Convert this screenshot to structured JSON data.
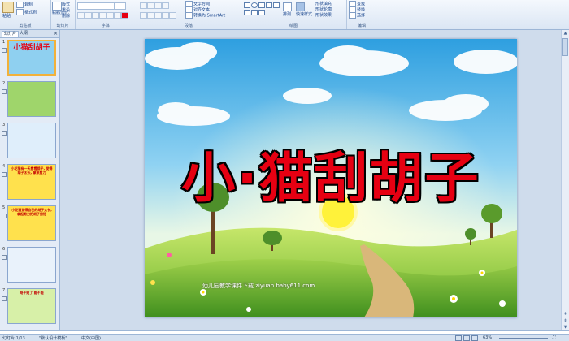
{
  "ribbon": {
    "clipboard": {
      "paste": "粘贴",
      "copy": "复制",
      "format_painter": "格式刷",
      "group": "剪贴板"
    },
    "slides": {
      "new_slide": "新建幻灯片",
      "layout": "版式",
      "reset": "重设",
      "delete": "删除",
      "group": "幻灯片"
    },
    "font": {
      "group": "字体"
    },
    "paragraph": {
      "text_direction": "文字方向",
      "align_text": "对齐文本",
      "convert_smartart": "转换为 SmartArt",
      "group": "段落"
    },
    "drawing": {
      "arrange": "排列",
      "quick_styles": "快速样式",
      "shape_fill": "形状填充",
      "shape_outline": "形状轮廓",
      "shape_effects": "形状效果",
      "group": "绘图"
    },
    "editing": {
      "find": "查找",
      "replace": "替换",
      "select": "选择",
      "group": "编辑"
    }
  },
  "pane": {
    "tabs": [
      "幻灯片",
      "大纲"
    ],
    "thumbnails": [
      {
        "num": "1",
        "text": "小猫刮胡子",
        "bg": "#8fd0f0",
        "color": "#e60012"
      },
      {
        "num": "2",
        "text": "",
        "bg": "#9fd56b",
        "color": "#333333"
      },
      {
        "num": "3",
        "text": "",
        "bg": "#dfeefb",
        "color": "#333333"
      },
      {
        "num": "4",
        "text": "小花猫有一天看看镜子, 觉得胡子太长, 拿来剪刀",
        "bg": "#ffe14d",
        "color": "#c40000"
      },
      {
        "num": "5",
        "text": "小花猫觉得自己的胡子太长, 拿起剪刀把胡子剪短",
        "bg": "#ffe14d",
        "color": "#c40000"
      },
      {
        "num": "6",
        "text": "",
        "bg": "#e9f2fb",
        "color": "#333333"
      },
      {
        "num": "7",
        "text": "胡子短了 能不能",
        "bg": "#d7f0a8",
        "color": "#c40000"
      }
    ]
  },
  "slide": {
    "title": "小·猫刮胡子",
    "credit": "幼儿园教学课件下载  ziyuan.baby611.com"
  },
  "status": {
    "slide_info": "幻灯片 1/13",
    "theme": "\"默认设计模板\"",
    "language": "中文(中国)",
    "zoom": "63%"
  },
  "colors": {
    "accent": "#e60012",
    "ribbon": "#dbe6f4",
    "pane": "#e3ebf6"
  }
}
